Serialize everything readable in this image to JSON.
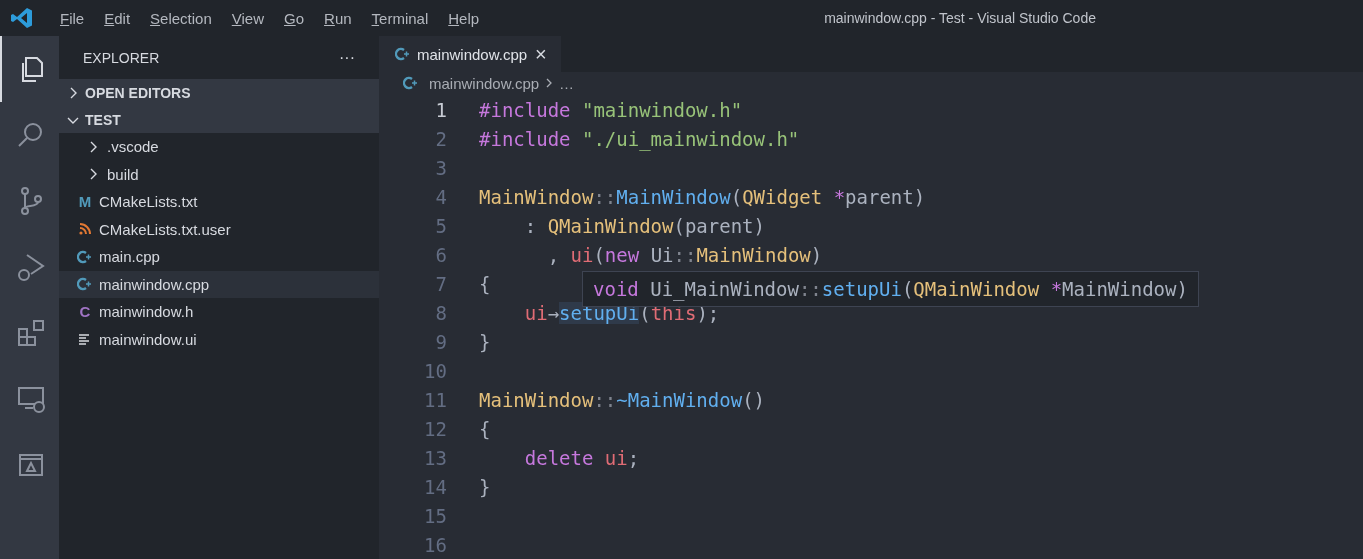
{
  "window": {
    "title": "mainwindow.cpp - Test - Visual Studio Code"
  },
  "menu": [
    "File",
    "Edit",
    "Selection",
    "View",
    "Go",
    "Run",
    "Terminal",
    "Help"
  ],
  "activity_bar": [
    {
      "kind": "files",
      "selected": true
    },
    {
      "kind": "search",
      "selected": false
    },
    {
      "kind": "source-control",
      "selected": false
    },
    {
      "kind": "run-debug",
      "selected": false
    },
    {
      "kind": "extensions",
      "selected": false
    },
    {
      "kind": "remote",
      "selected": false
    },
    {
      "kind": "panel",
      "selected": false
    }
  ],
  "sidebar": {
    "title": "EXPLORER",
    "more": "···",
    "sections": [
      {
        "label": "OPEN EDITORS",
        "expanded": false
      },
      {
        "label": "TEST",
        "expanded": true,
        "items": [
          {
            "kind": "folder",
            "label": ".vscode",
            "expanded": false,
            "selected": false
          },
          {
            "kind": "folder",
            "label": "build",
            "expanded": false,
            "selected": false
          },
          {
            "kind": "letter",
            "icon_text": "M",
            "color": "#519aba",
            "label": "CMakeLists.txt",
            "selected": false
          },
          {
            "kind": "feed",
            "label": "CMakeLists.txt.user",
            "selected": false
          },
          {
            "kind": "cpp",
            "label": "main.cpp",
            "selected": false
          },
          {
            "kind": "cpp",
            "label": "mainwindow.cpp",
            "selected": true
          },
          {
            "kind": "letter",
            "icon_text": "C",
            "color": "#a074c4",
            "label": "mainwindow.h",
            "selected": false
          },
          {
            "kind": "text",
            "label": "mainwindow.ui",
            "selected": false
          }
        ]
      }
    ]
  },
  "tabs": [
    {
      "label": "mainwindow.cpp",
      "selected": true,
      "close": "×"
    }
  ],
  "breadcrumb": [
    "mainwindow.cpp",
    "…"
  ],
  "code": [
    {
      "number": "1",
      "tokens": [
        {
          "kind": "preproc",
          "text": "#include"
        },
        {
          "kind": "string",
          "text": " \"mainwindow.h\""
        }
      ]
    },
    {
      "number": "2",
      "tokens": [
        {
          "kind": "preproc",
          "text": "#include"
        },
        {
          "kind": "string",
          "text": " \"./ui_mainwindow.h\""
        }
      ]
    },
    {
      "number": "3"
    },
    {
      "number": "4",
      "tokens": [
        {
          "kind": "type",
          "text": "MainWindow"
        },
        {
          "kind": "punct",
          "text": "::"
        },
        {
          "kind": "func",
          "text": "MainWindow"
        },
        {
          "kind": "plain",
          "text": "("
        },
        {
          "kind": "type",
          "text": "QWidget"
        },
        {
          "kind": "keyword",
          "text": " *"
        },
        {
          "kind": "plain",
          "text": "parent)"
        }
      ]
    },
    {
      "number": "5",
      "tokens": [
        {
          "kind": "plain",
          "text": "    : "
        },
        {
          "kind": "type",
          "text": "QMainWindow"
        },
        {
          "kind": "plain",
          "text": "(parent)"
        }
      ]
    },
    {
      "number": "6",
      "tokens": [
        {
          "kind": "plain",
          "text": "      , "
        },
        {
          "kind": "var",
          "text": "ui"
        },
        {
          "kind": "plain",
          "text": "("
        },
        {
          "kind": "keyword",
          "text": "new"
        },
        {
          "kind": "plain",
          "text": " Ui"
        },
        {
          "kind": "punct",
          "text": "::"
        },
        {
          "kind": "type",
          "text": "MainWindow"
        },
        {
          "kind": "plain",
          "text": ")"
        }
      ]
    },
    {
      "number": "7",
      "tokens": [
        {
          "kind": "plain",
          "text": "{"
        }
      ]
    },
    {
      "number": "8",
      "tokens": [
        {
          "kind": "var",
          "text": "    ui"
        },
        {
          "kind": "plain",
          "text": "→"
        },
        {
          "kind": "func",
          "text": "setupUi",
          "highlighted": true
        },
        {
          "kind": "plain",
          "text": "("
        },
        {
          "kind": "var",
          "text": "this"
        },
        {
          "kind": "plain",
          "text": ");"
        }
      ]
    },
    {
      "number": "9",
      "tokens": [
        {
          "kind": "plain",
          "text": "}"
        }
      ]
    },
    {
      "number": "10"
    },
    {
      "number": "11",
      "tokens": [
        {
          "kind": "type",
          "text": "MainWindow"
        },
        {
          "kind": "punct",
          "text": "::"
        },
        {
          "kind": "func",
          "text": "~MainWindow"
        },
        {
          "kind": "plain",
          "text": "()"
        }
      ]
    },
    {
      "number": "12",
      "tokens": [
        {
          "kind": "plain",
          "text": "{"
        }
      ]
    },
    {
      "number": "13",
      "tokens": [
        {
          "kind": "keyword",
          "text": "    delete"
        },
        {
          "kind": "var",
          "text": " ui"
        },
        {
          "kind": "plain",
          "text": ";"
        }
      ]
    },
    {
      "number": "14",
      "tokens": [
        {
          "kind": "plain",
          "text": "}"
        }
      ]
    },
    {
      "number": "15"
    },
    {
      "number": "16"
    }
  ],
  "hover": {
    "tokens": [
      {
        "kind": "keyword",
        "text": "void"
      },
      {
        "kind": "plain",
        "text": " Ui_MainWindow"
      },
      {
        "kind": "punct",
        "text": "::"
      },
      {
        "kind": "func",
        "text": "setupUi"
      },
      {
        "kind": "plain",
        "text": "("
      },
      {
        "kind": "type",
        "text": "QMainWindow"
      },
      {
        "kind": "keyword",
        "text": " *"
      },
      {
        "kind": "plain",
        "text": "MainWindow)"
      }
    ]
  }
}
